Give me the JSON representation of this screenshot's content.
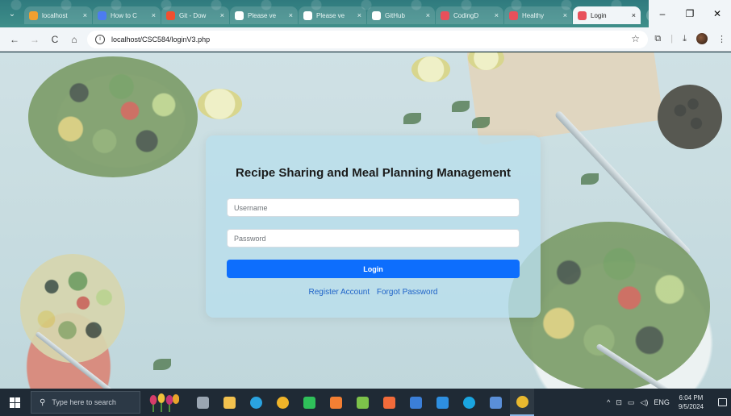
{
  "browser": {
    "tabs": [
      {
        "title": "localhost",
        "favicon_color": "#f0a030",
        "active": false
      },
      {
        "title": "How to C",
        "favicon_color": "#4c7cf0",
        "active": false
      },
      {
        "title": "Git - Dow",
        "favicon_color": "#f05030",
        "active": false
      },
      {
        "title": "Please ve",
        "favicon_color": "#ffffff",
        "active": false
      },
      {
        "title": "Please ve",
        "favicon_color": "#ffffff",
        "active": false
      },
      {
        "title": "GitHub",
        "favicon_color": "#ffffff",
        "active": false
      },
      {
        "title": "CodingD",
        "favicon_color": "#e8505b",
        "active": false
      },
      {
        "title": "Healthy",
        "favicon_color": "#e8505b",
        "active": false
      },
      {
        "title": "Login",
        "favicon_color": "#e8505b",
        "active": true
      }
    ],
    "tab_close_glyph": "×",
    "new_tab_glyph": "+",
    "window_controls": {
      "minimize": "–",
      "maximize": "❐",
      "close": "✕"
    },
    "nav": {
      "back": "←",
      "forward": "→",
      "reload": "C",
      "home": "⌂"
    },
    "address_bar": {
      "url": "localhost/CSC584/loginV3.php",
      "bookmark_glyph": "☆"
    },
    "toolbar_icons": {
      "extensions": "⧉",
      "separator": "|",
      "downloads": "⤓"
    }
  },
  "login": {
    "title": "Recipe Sharing and Meal Planning Management",
    "username_placeholder": "Username",
    "password_placeholder": "Password",
    "login_label": "Login",
    "register_link": "Register Account",
    "forgot_link": "Forgot Password"
  },
  "taskbar": {
    "search_placeholder": "Type here to search",
    "search_glyph": "⚲",
    "apps": [
      {
        "name": "task-view",
        "color": "#9aa6b2",
        "active": false
      },
      {
        "name": "file-explorer",
        "color": "#f2c14e",
        "active": false
      },
      {
        "name": "telegram",
        "color": "#2aa3e0",
        "active": false
      },
      {
        "name": "chrome-canary",
        "color": "#f0b429",
        "active": false
      },
      {
        "name": "whatsapp",
        "color": "#2fc05a",
        "active": false
      },
      {
        "name": "xampp",
        "color": "#f37f33",
        "active": false
      },
      {
        "name": "android-studio",
        "color": "#7cc24a",
        "active": false
      },
      {
        "name": "postman",
        "color": "#f26b3a",
        "active": false
      },
      {
        "name": "docker",
        "color": "#3b7fd8",
        "active": false
      },
      {
        "name": "vscode",
        "color": "#2e8fe0",
        "active": false
      },
      {
        "name": "edge",
        "color": "#1aa5e0",
        "active": false
      },
      {
        "name": "virtualbox",
        "color": "#5a8fd8",
        "active": false
      },
      {
        "name": "chrome",
        "color": "#e9b92f",
        "active": true
      }
    ],
    "tray": {
      "chevron": "^",
      "network": "⊡",
      "battery": "▭",
      "volume": "◁)",
      "language": "ENG",
      "time": "6:04 PM",
      "date": "9/5/2024"
    }
  }
}
